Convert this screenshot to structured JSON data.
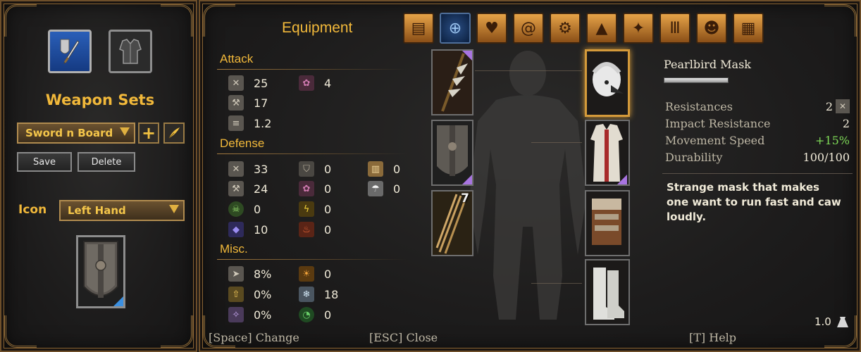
{
  "left": {
    "weapon_sets_title": "Weapon Sets",
    "selected_set": "Sword n Board",
    "add_symbol": "+",
    "save_label": "Save",
    "delete_label": "Delete",
    "icon_label": "Icon",
    "icon_value": "Left Hand",
    "set_tabs": [
      {
        "name": "weapon-set-tab",
        "icon": "sword-shield-icon",
        "active": true
      },
      {
        "name": "armor-set-tab",
        "icon": "armor-icon",
        "active": false
      }
    ]
  },
  "main": {
    "title": "Equipment",
    "tabs": [
      {
        "icon": "backpack-icon",
        "active": false
      },
      {
        "icon": "equipment-icon",
        "active": true
      },
      {
        "icon": "heart-icon",
        "active": false
      },
      {
        "icon": "spiral-icon",
        "active": false
      },
      {
        "icon": "crafting-icon",
        "active": false
      },
      {
        "icon": "camp-icon",
        "active": false
      },
      {
        "icon": "skills-icon",
        "active": false
      },
      {
        "icon": "quests-icon",
        "active": false
      },
      {
        "icon": "character-icon",
        "active": false
      },
      {
        "icon": "journal-icon",
        "active": false
      }
    ]
  },
  "stats": {
    "attack_title": "Attack",
    "attack": [
      {
        "icon": "physical-damage-icon",
        "value": "25"
      },
      {
        "icon": "decay-damage-icon",
        "value": "4"
      },
      {
        "icon": "impact-icon",
        "value": "17"
      },
      {
        "icon": "attack-speed-icon",
        "value": "1.2"
      }
    ],
    "defense_title": "Defense",
    "defense": [
      {
        "icon": "physical-resist-icon",
        "value": "33"
      },
      {
        "icon": "protection-icon",
        "value": "0"
      },
      {
        "icon": "barrier-icon",
        "value": "0"
      },
      {
        "icon": "impact-resist-icon",
        "value": "24"
      },
      {
        "icon": "decay-resist-icon",
        "value": "0"
      },
      {
        "icon": "hot-weather-icon",
        "value": "0"
      },
      {
        "icon": "corruption-resist-icon",
        "value": "0"
      },
      {
        "icon": "lightning-resist-icon",
        "value": "0"
      },
      {
        "icon": "ethereal-resist-icon",
        "value": "10"
      },
      {
        "icon": "fire-resist-icon",
        "value": "0"
      }
    ],
    "misc_title": "Misc.",
    "misc": [
      {
        "icon": "movement-icon",
        "value": "8%"
      },
      {
        "icon": "heat-icon",
        "value": "0"
      },
      {
        "icon": "stamina-cost-icon",
        "value": "0%"
      },
      {
        "icon": "cold-icon",
        "value": "18"
      },
      {
        "icon": "mana-cost-icon",
        "value": "0%"
      },
      {
        "icon": "cooldown-icon",
        "value": "0"
      }
    ]
  },
  "slots": [
    {
      "name": "main-hand-slot",
      "item": "halberd"
    },
    {
      "name": "off-hand-slot",
      "item": "shield"
    },
    {
      "name": "quiver-slot",
      "item": "arrows",
      "quantity": "7"
    },
    {
      "name": "head-slot",
      "item": "pearlbird-mask"
    },
    {
      "name": "chest-slot",
      "item": "robe"
    },
    {
      "name": "backpack-slot",
      "item": "backpack"
    },
    {
      "name": "feet-slot",
      "item": "boots"
    }
  ],
  "details": {
    "item_name": "Pearlbird Mask",
    "rows": [
      {
        "label": "Resistances",
        "value": "2"
      },
      {
        "label": "Impact Resistance",
        "value": "2"
      },
      {
        "label": "Movement Speed",
        "value": "+15%"
      },
      {
        "label": "Durability",
        "value": "100/100"
      }
    ],
    "description": "Strange mask that makes one want to run fast and caw loudly.",
    "weight": "1.0"
  },
  "hints": {
    "change": "[Space] Change",
    "close": "[ESC] Close",
    "help": "[T] Help"
  },
  "colors": {
    "accent_gold": "#f1b83a",
    "frame_bronze": "#8a6434",
    "selected_slot": "#d49a3a",
    "positive_green": "#7ed957"
  }
}
